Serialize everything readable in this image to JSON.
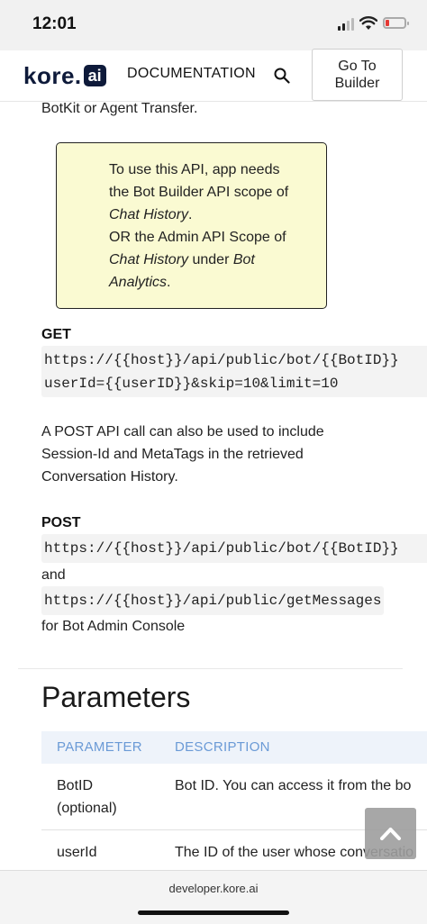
{
  "status": {
    "time": "12:01"
  },
  "header": {
    "logo_text": "kore",
    "logo_badge": "ai",
    "nav_documentation": "DOCUMENTATION",
    "search_icon": "search-icon",
    "goto_line1": "Go To",
    "goto_line2": "Builder"
  },
  "content": {
    "intro_line": "BotKit or Agent Transfer.",
    "note": {
      "l1": "To use this API, app needs",
      "l2": "the Bot Builder API scope of",
      "l3_italic": "Chat History",
      "l3_end": ".",
      "l4": "OR the Admin API Scope of",
      "l5_italic": "Chat History",
      "l5_mid": " under ",
      "l5_italic2": "Bot",
      "l6_italic": "Analytics",
      "l6_end": "."
    },
    "get_label": "GET",
    "get_url_1": "https://{{host}}/api/public/bot/{{BotID}}",
    "get_url_2": "userId={{userID}}&skip=10&limit=10",
    "post_desc_1": "A POST API call can also be used to include",
    "post_desc_2": "Session-Id and MetaTags in the retrieved",
    "post_desc_3": "Conversation History.",
    "post_label": "POST",
    "post_url_1": "https://{{host}}/api/public/bot/{{BotID}}",
    "and_text": "and",
    "post_url_2": "https://{{host}}/api/public/getMessages",
    "admin_text": "for Bot Admin Console",
    "params_heading": "Parameters",
    "table": {
      "col_parameter": "PARAMETER",
      "col_description": "DESCRIPTION",
      "rows": [
        {
          "param_1": "BotID",
          "param_2": "(optional)",
          "desc": "Bot ID. You can access it from the bo"
        },
        {
          "param_1": "userId",
          "desc": "The ID of the user whose conversatio"
        }
      ]
    }
  },
  "bottom": {
    "url": "developer.kore.ai"
  }
}
